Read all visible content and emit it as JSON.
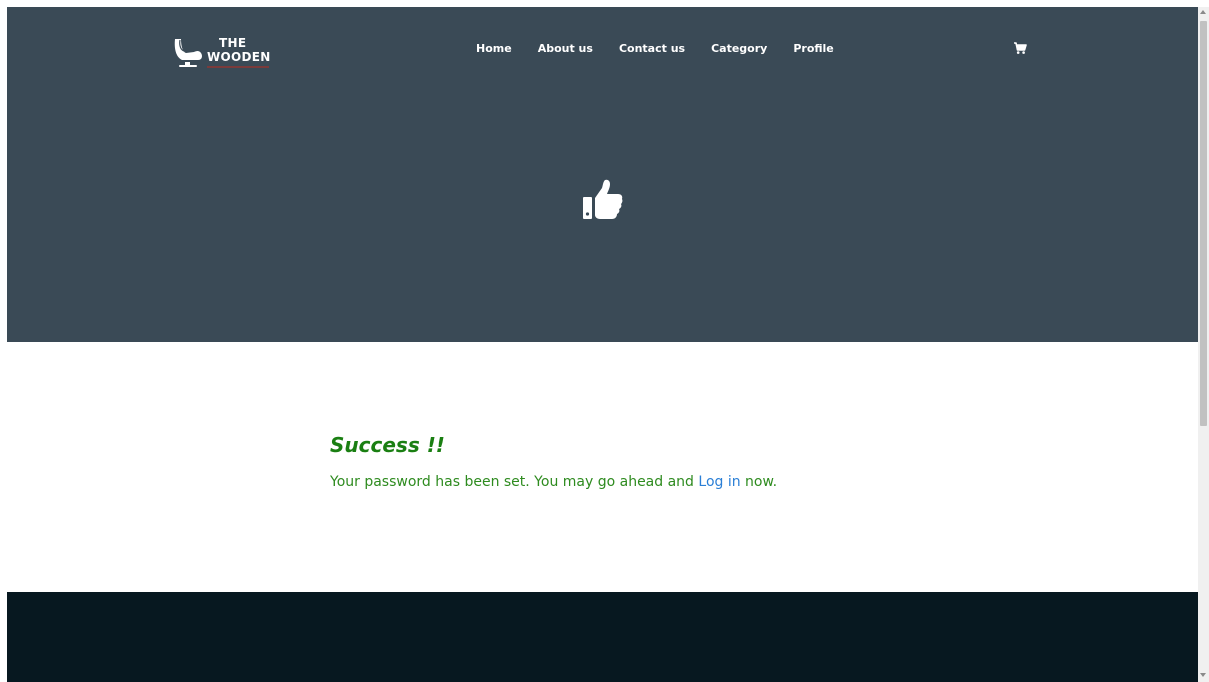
{
  "header": {
    "logo": {
      "line1": "THE",
      "line2": "WOODEN",
      "icon": "chair-icon"
    },
    "nav": [
      {
        "label": "Home"
      },
      {
        "label": "About us"
      },
      {
        "label": "Contact us"
      },
      {
        "label": "Category"
      },
      {
        "label": "Profile"
      }
    ],
    "cart_icon": "cart-icon"
  },
  "hero": {
    "icon": "thumbs-up-icon",
    "background": "#3a4a56"
  },
  "message": {
    "title": "Success !!",
    "text_before": "Your password has been set. You may go ahead and ",
    "link_label": "Log in",
    "text_after": " now.",
    "title_color": "#1a7f12",
    "text_color": "#2e8b1f",
    "link_color": "#2b7fd6"
  },
  "footer": {
    "background": "#071820"
  }
}
